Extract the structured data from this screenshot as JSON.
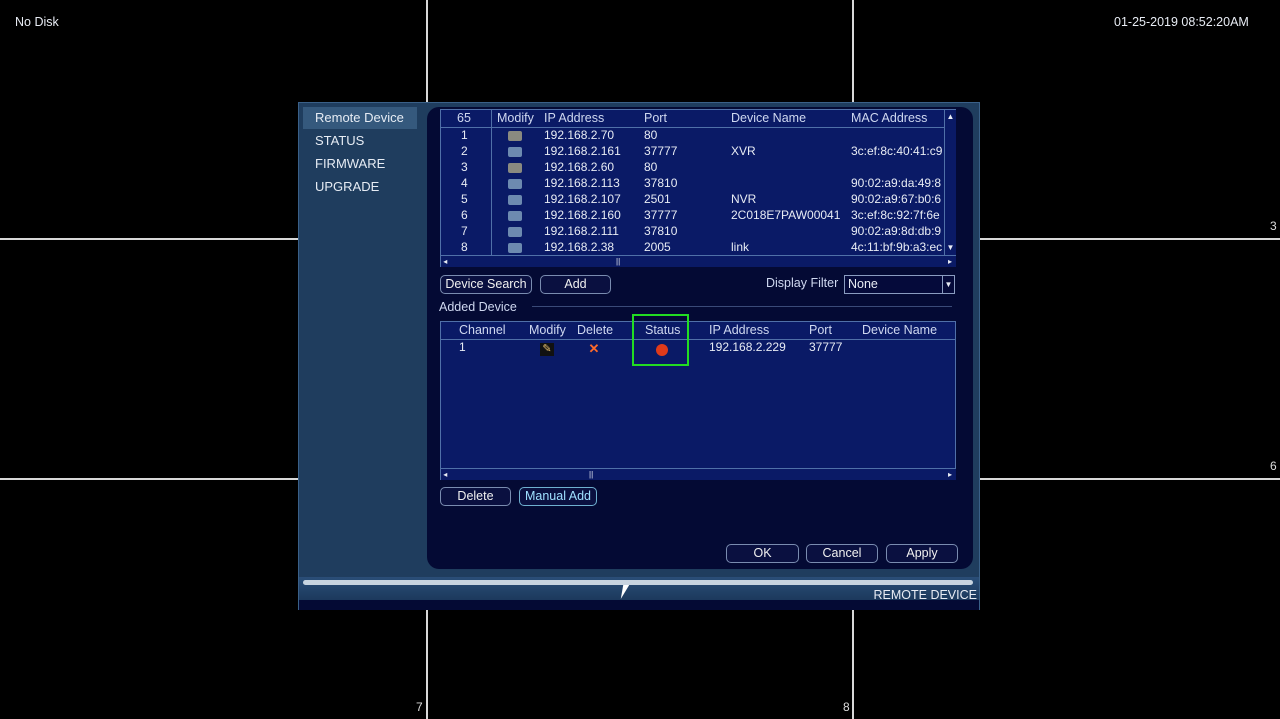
{
  "screen": {
    "disk_status": "No Disk",
    "datetime": "01-25-2019 08:52:20AM",
    "channel_labels": [
      "3",
      "6",
      "7",
      "8"
    ]
  },
  "sidebar": {
    "items": [
      {
        "label": "Remote Device",
        "active": true
      },
      {
        "label": "STATUS"
      },
      {
        "label": "FIRMWARE"
      },
      {
        "label": "UPGRADE"
      }
    ]
  },
  "search_table": {
    "headers": [
      "65",
      "Modify",
      "IP Address",
      "Port",
      "Device Name",
      "MAC Address"
    ],
    "rows": [
      {
        "no": "1",
        "ip": "192.168.2.70",
        "port": "80",
        "name": "",
        "mac": "",
        "icon": "grey"
      },
      {
        "no": "2",
        "ip": "192.168.2.161",
        "port": "37777",
        "name": "XVR",
        "mac": "3c:ef:8c:40:41:c9",
        "icon": "blue"
      },
      {
        "no": "3",
        "ip": "192.168.2.60",
        "port": "80",
        "name": "",
        "mac": "",
        "icon": "grey"
      },
      {
        "no": "4",
        "ip": "192.168.2.113",
        "port": "37810",
        "name": "",
        "mac": "90:02:a9:da:49:8",
        "icon": "blue"
      },
      {
        "no": "5",
        "ip": "192.168.2.107",
        "port": "2501",
        "name": "NVR",
        "mac": "90:02:a9:67:b0:6",
        "icon": "blue"
      },
      {
        "no": "6",
        "ip": "192.168.2.160",
        "port": "37777",
        "name": "2C018E7PAW00041",
        "mac": "3c:ef:8c:92:7f:6e",
        "icon": "blue"
      },
      {
        "no": "7",
        "ip": "192.168.2.111",
        "port": "37810",
        "name": "",
        "mac": "90:02:a9:8d:db:9",
        "icon": "blue"
      },
      {
        "no": "8",
        "ip": "192.168.2.38",
        "port": "2005",
        "name": "link",
        "mac": "4c:11:bf:9b:a3:ec",
        "icon": "blue"
      }
    ]
  },
  "buttons": {
    "device_search": "Device Search",
    "add": "Add",
    "delete": "Delete",
    "manual_add": "Manual Add",
    "ok": "OK",
    "cancel": "Cancel",
    "apply": "Apply"
  },
  "display_filter": {
    "label": "Display Filter",
    "value": "None"
  },
  "added_device": {
    "section_label": "Added Device",
    "headers": [
      "Channel",
      "Modify",
      "Delete",
      "Status",
      "IP Address",
      "Port",
      "Device Name"
    ],
    "rows": [
      {
        "channel": "1",
        "status": "offline",
        "status_color": "#e03a1a",
        "ip": "192.168.2.229",
        "port": "37777",
        "name": ""
      }
    ]
  },
  "highlight_color": "#22dd22",
  "footer": {
    "title": "REMOTE DEVICE"
  }
}
